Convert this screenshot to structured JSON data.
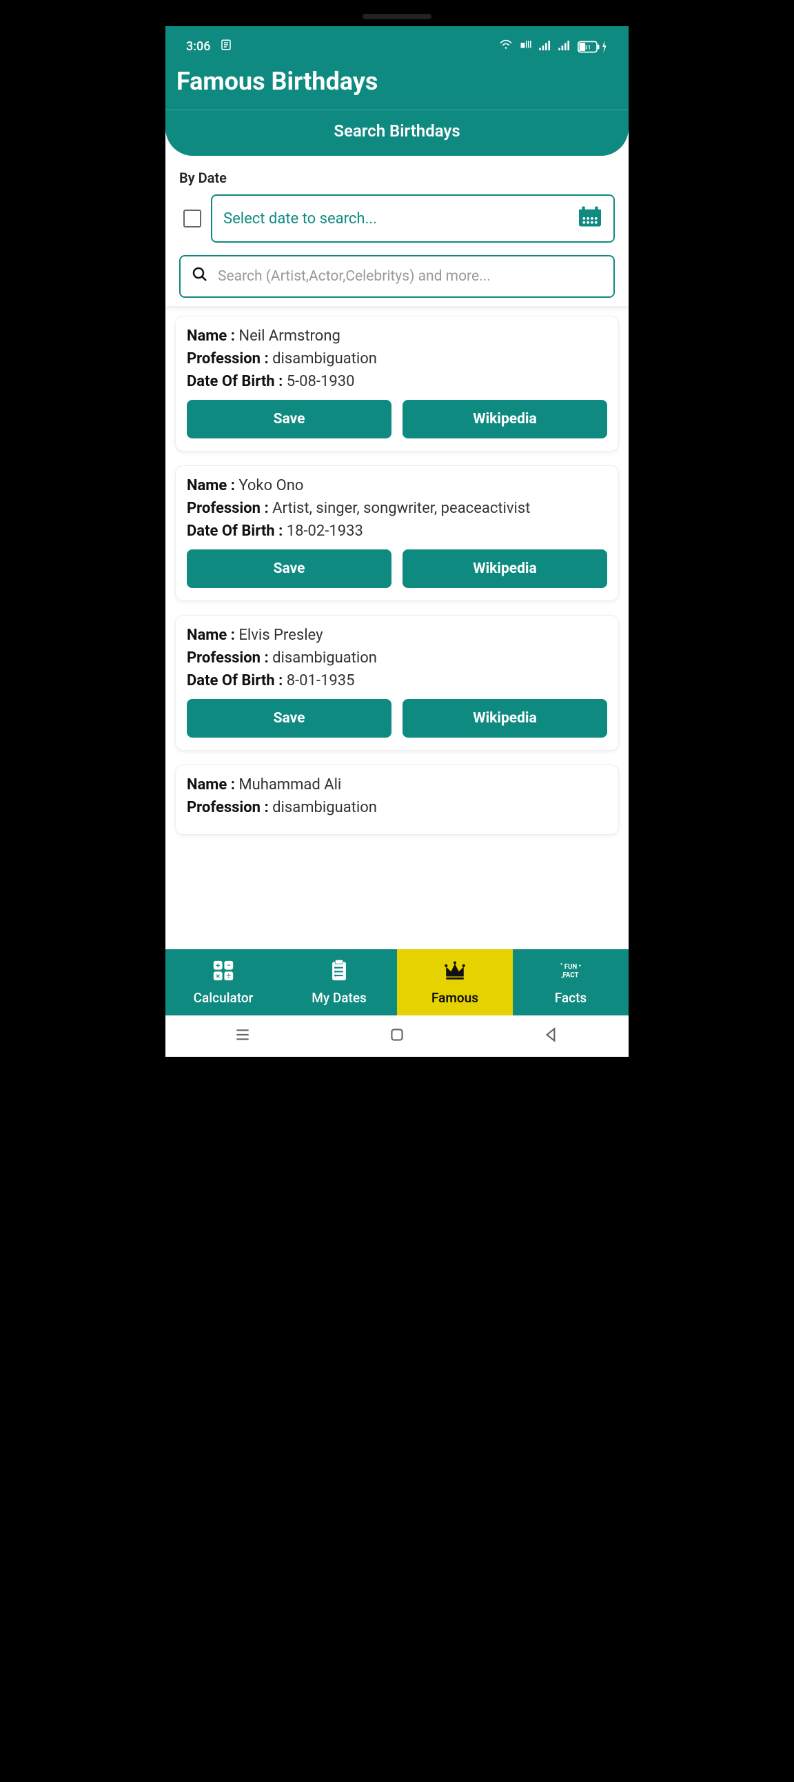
{
  "status": {
    "time": "3:06",
    "battery": "31"
  },
  "header": {
    "title": "Famous Birthdays",
    "search_title": "Search Birthdays"
  },
  "filter": {
    "by_date_label": "By Date",
    "date_placeholder": "Select date to search...",
    "search_placeholder": "Search (Artist,Actor,Celebritys) and more..."
  },
  "labels": {
    "name": "Name :",
    "profession": "Profession :",
    "dob": "Date Of Birth :",
    "save": "Save",
    "wikipedia": "Wikipedia"
  },
  "people": [
    {
      "name": "Neil Armstrong",
      "profession": "disambiguation",
      "dob": "5-08-1930"
    },
    {
      "name": "Yoko Ono",
      "profession": "Artist, singer, songwriter, peaceactivist",
      "dob": "18-02-1933"
    },
    {
      "name": "Elvis Presley",
      "profession": "disambiguation",
      "dob": "8-01-1935"
    },
    {
      "name": "Muhammad Ali",
      "profession": "disambiguation",
      "dob": ""
    }
  ],
  "nav": {
    "calculator": "Calculator",
    "mydates": "My Dates",
    "famous": "Famous",
    "facts": "Facts"
  }
}
